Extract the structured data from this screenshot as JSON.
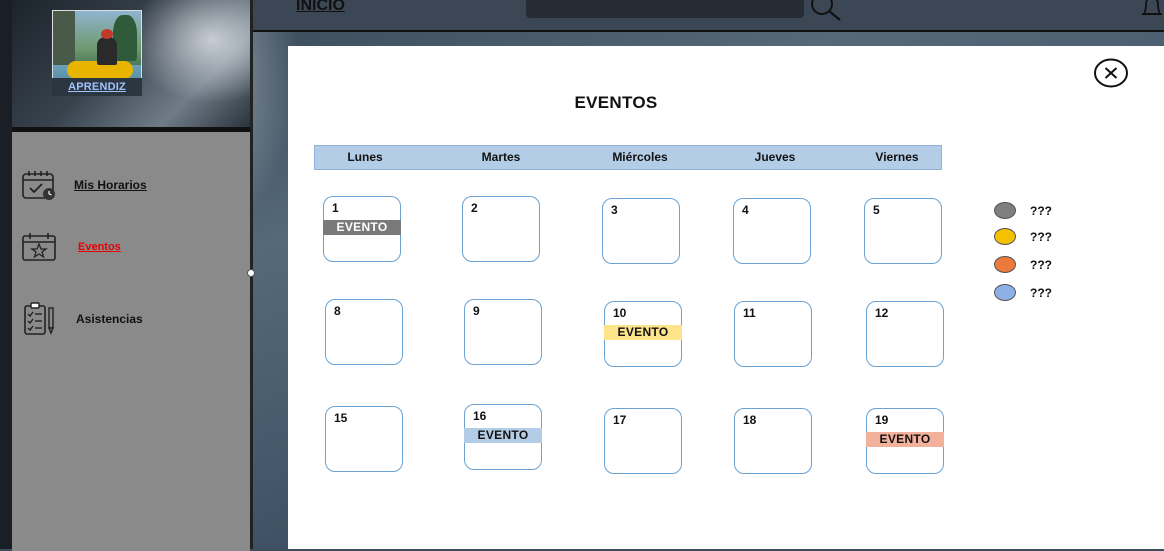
{
  "profile": {
    "name_label": "APRENDIZ"
  },
  "topbar": {
    "home_label": "INICIO"
  },
  "sidebar": {
    "items": [
      {
        "label": "Mis Horarios",
        "icon": "calendar-check-icon"
      },
      {
        "label": "Eventos",
        "icon": "calendar-star-icon",
        "active": true,
        "active_color": "#e80000"
      },
      {
        "label": "Asistencias",
        "icon": "clipboard-list-icon"
      }
    ]
  },
  "modal": {
    "title": "EVENTOS",
    "weekdays": [
      "Lunes",
      "Martes",
      "Miércoles",
      "Jueves",
      "Viernes"
    ],
    "days": [
      {
        "num": "1",
        "event": "EVENTO",
        "event_color": "#7a7a7a",
        "event_text_color": "#ffffff"
      },
      {
        "num": "2"
      },
      {
        "num": "3"
      },
      {
        "num": "4"
      },
      {
        "num": "5"
      },
      {
        "num": "8"
      },
      {
        "num": "9"
      },
      {
        "num": "10",
        "event": "EVENTO",
        "event_color": "#fde38a",
        "event_text_color": "#111111"
      },
      {
        "num": "11"
      },
      {
        "num": "12"
      },
      {
        "num": "15"
      },
      {
        "num": "16",
        "event": "EVENTO",
        "event_color": "#b4cde6",
        "event_text_color": "#111111"
      },
      {
        "num": "17"
      },
      {
        "num": "18"
      },
      {
        "num": "19",
        "event": "EVENTO",
        "event_color": "#f3b19c",
        "event_text_color": "#111111"
      }
    ],
    "legend": [
      {
        "label": "???",
        "color": "#7f7f7f"
      },
      {
        "label": "???",
        "color": "#f5c000"
      },
      {
        "label": "???",
        "color": "#ec7a3a"
      },
      {
        "label": "???",
        "color": "#8fb0e6"
      }
    ]
  },
  "colors": {
    "accent": "#b4cde6",
    "sidebar": "#8a8a8a",
    "day_border": "#6aa2d3"
  }
}
